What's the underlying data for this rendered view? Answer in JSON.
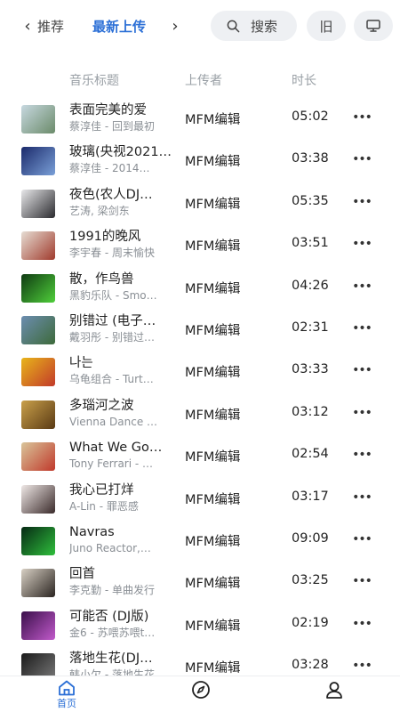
{
  "top_nav": {
    "prev_tab": "推荐",
    "active_tab": "最新上传",
    "search_label": "搜索",
    "old_label": "旧"
  },
  "columns": {
    "title": "音乐标题",
    "uploader": "上传者",
    "duration": "时长"
  },
  "songs": [
    {
      "title": "表面完美的爱",
      "subtitle": "蔡淳佳 - 回到最初",
      "uploader": "MFM编辑",
      "duration": "05:02",
      "cover": [
        "#c7d8e0",
        "#6b8b6a"
      ]
    },
    {
      "title": "玻璃(央视2021…",
      "subtitle": "蔡淳佳 - 2014…",
      "uploader": "MFM编辑",
      "duration": "03:38",
      "cover": [
        "#1b2a6b",
        "#7aa0d8"
      ]
    },
    {
      "title": "夜色(农人DJ…",
      "subtitle": "艺涛, 梁剑东",
      "uploader": "MFM编辑",
      "duration": "05:35",
      "cover": [
        "#e8e8ea",
        "#2a2a2e"
      ]
    },
    {
      "title": "1991的晚风",
      "subtitle": "李宇春 - 周末愉快",
      "uploader": "MFM编辑",
      "duration": "03:51",
      "cover": [
        "#e6ddd3",
        "#a03a2c"
      ]
    },
    {
      "title": "散，作鸟兽",
      "subtitle": "黑豹乐队 - Smo…",
      "uploader": "MFM编辑",
      "duration": "04:26",
      "cover": [
        "#0f3a12",
        "#4fcf3a"
      ]
    },
    {
      "title": "别错过 (电子…",
      "subtitle": "戴羽彤 - 别错过…",
      "uploader": "MFM编辑",
      "duration": "02:31",
      "cover": [
        "#6c8db0",
        "#3d6a3a"
      ]
    },
    {
      "title": "나는",
      "subtitle": "乌龟组合 - Turt…",
      "uploader": "MFM编辑",
      "duration": "03:33",
      "cover": [
        "#e8b51a",
        "#c23a2a"
      ]
    },
    {
      "title": "多瑙河之波",
      "subtitle": "Vienna Dance …",
      "uploader": "MFM编辑",
      "duration": "03:12",
      "cover": [
        "#c9a04a",
        "#5a3a14"
      ]
    },
    {
      "title": "What We Go…",
      "subtitle": "Tony Ferrari - …",
      "uploader": "MFM编辑",
      "duration": "02:54",
      "cover": [
        "#d9c59a",
        "#c0392b"
      ]
    },
    {
      "title": "我心已打烊",
      "subtitle": "A-Lin - 罪恶感",
      "uploader": "MFM编辑",
      "duration": "03:17",
      "cover": [
        "#efe8e6",
        "#3a2a2a"
      ]
    },
    {
      "title": "Navras",
      "subtitle": "Juno Reactor,…",
      "uploader": "MFM编辑",
      "duration": "09:09",
      "cover": [
        "#062914",
        "#2fbf3c"
      ]
    },
    {
      "title": "回首",
      "subtitle": "李克勤 - 单曲发行",
      "uploader": "MFM编辑",
      "duration": "03:25",
      "cover": [
        "#d8d0c4",
        "#2a2420"
      ]
    },
    {
      "title": "可能否 (DJ版)",
      "subtitle": "金6 - 苏喂苏喂t…",
      "uploader": "MFM编辑",
      "duration": "02:19",
      "cover": [
        "#3a0f4a",
        "#c15acb"
      ]
    },
    {
      "title": "落地生花(DJ…",
      "subtitle": "韩小欠 - 落地生花",
      "uploader": "MFM编辑",
      "duration": "03:28",
      "cover": [
        "#1a1a1a",
        "#7a7a7a"
      ]
    }
  ],
  "bottom_nav": {
    "home_label": "首页"
  },
  "colors": {
    "accent": "#2b6fd6",
    "pill_bg": "#eef0f3"
  },
  "icons": {
    "search": "search-icon",
    "tv": "tv-icon",
    "home": "home-icon",
    "discover": "compass-icon",
    "profile": "person-icon",
    "more": "more-icon"
  }
}
